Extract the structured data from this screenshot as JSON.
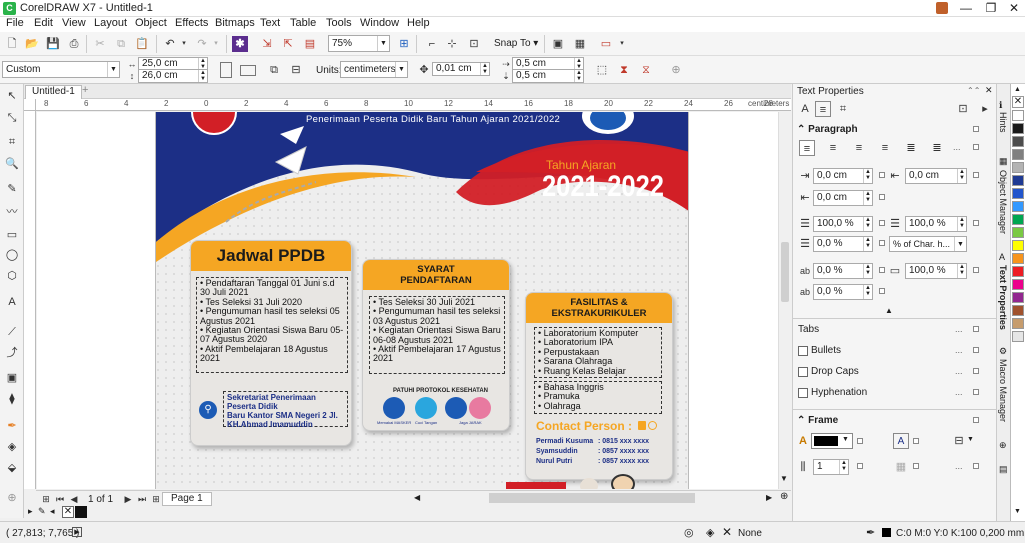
{
  "window": {
    "title": "CorelDRAW X7 - Untitled-1",
    "min": "—",
    "restore": "❐",
    "close": "✕"
  },
  "menu": [
    "File",
    "Edit",
    "View",
    "Layout",
    "Object",
    "Effects",
    "Bitmaps",
    "Text",
    "Table",
    "Tools",
    "Window",
    "Help"
  ],
  "toolbar": {
    "zoom": "75%",
    "snap": "Snap To"
  },
  "propbar": {
    "preset": "Custom",
    "width": "25,0 cm",
    "height": "26,0 cm",
    "units_label": "Units:",
    "units": "centimeters",
    "nudge": "0,01 cm",
    "dup_x": "0,5 cm",
    "dup_y": "0,5 cm"
  },
  "doc_tab": "Untitled-1",
  "ruler": {
    "marks": [
      "8",
      "6",
      "4",
      "2",
      "0",
      "2",
      "4",
      "6",
      "8",
      "10",
      "12",
      "14",
      "16",
      "18",
      "20",
      "22",
      "24",
      "26",
      "28",
      "30",
      "32"
    ],
    "unit": "centimeters"
  },
  "page_nav": {
    "page_of": "1 of 1",
    "page_tab": "Page 1"
  },
  "status": {
    "coords": "( 27,813; 7,765 )",
    "fill": "None",
    "outline": "C:0 M:0 Y:0 K:100  0,200 mm"
  },
  "panel": {
    "title": "Text Properties",
    "paragraph": "Paragraph",
    "fields": {
      "left_indent": "0,0 cm",
      "first_line": "0,0 cm",
      "right_indent": "0,0 cm",
      "line_spacing": "100,0 %",
      "char_spacing": "100,0 %",
      "before_para": "0,0 %",
      "spacing_unit": "% of Char. h...",
      "after_para": "0,0 %",
      "lang": "0,0 %",
      "word": "100,0 %",
      "extra": "0,0 %"
    },
    "tabs": "Tabs",
    "bullets": "Bullets",
    "drop_caps": "Drop Caps",
    "hyphenation": "Hyphenation",
    "frame": "Frame",
    "columns": "1"
  },
  "side_tabs": [
    "Hints",
    "Object Manager",
    "Text Properties",
    "Macro Manager"
  ],
  "palette": [
    "#ffffff",
    "#1a1a1a",
    "#4d4d4d",
    "#808080",
    "#b3b3b3",
    "#1f3a93",
    "#2255cc",
    "#3399ff",
    "#00a651",
    "#7ac943",
    "#ffff00",
    "#f7941d",
    "#ed1c24",
    "#ec008c",
    "#92278f",
    "#a0522d",
    "#c69c6d",
    "#e6e6e6"
  ],
  "poster": {
    "header_tagline": "Penerimaan Peserta Didik Baru Tahun Ajaran 2021/2022",
    "tahun_label": "Tahun Ajaran",
    "tahun_value": "2021-2022",
    "jadwal_title": "Jadwal PPDB",
    "jadwal_items": [
      "Pendaftaran Tanggal 01 Juni s.d 30 Juli 2021",
      "Tes Seleksi 31 Juli 2020",
      "Pengumuman hasil tes seleksi 05 Agustus 2021",
      "Kegiatan Orientasi Siswa Baru 05-07 Agustus 2020",
      "Aktif Pembelajaran 18 Agustus 2021"
    ],
    "sekretariat": [
      "Sekretariat Penerimaan Peserta Didik",
      "Baru Kantor SMA Negeri 2 Jl. KH.Ahmad Imamuddin"
    ],
    "syarat_title": "SYARAT PENDAFTARAN",
    "syarat_items": [
      "Tes Seleksi 30 Juli 2021",
      "Pengumuman hasil tes seleksi 03 Agustus 2021",
      "Kegiatan Orientasi Siswa Baru 06-08 Agustus 2021",
      "Aktif Pembelajaran 17 Agustus 2021"
    ],
    "protokol": "PATUHI PROTOKOL KESEHATAN",
    "protokol_icons": [
      "Memakai MASKER",
      "Cuci Tangan",
      "Jaga JARAK"
    ],
    "fasilitas_title": "FASILITAS & EKSTRAKURIKULER",
    "fasilitas_items": [
      "Laboratorium Komputer",
      "Laboratorium IPA",
      "Perpustakaan",
      "Sarana Olahraga",
      "Ruang Kelas Belajar"
    ],
    "ekskul_items": [
      "Bahasa Inggris",
      "Pramuka",
      "Olahraga"
    ],
    "contact_title": "Contact Person :",
    "contacts": [
      {
        "name": "Permadi Kusuma",
        "phone": ": 0815 xxx xxxx"
      },
      {
        "name": "Syamsuddin",
        "phone": ": 0857 xxxx xxx"
      },
      {
        "name": "Nurul Putri",
        "phone": ": 0857 xxxx xxx"
      }
    ]
  }
}
